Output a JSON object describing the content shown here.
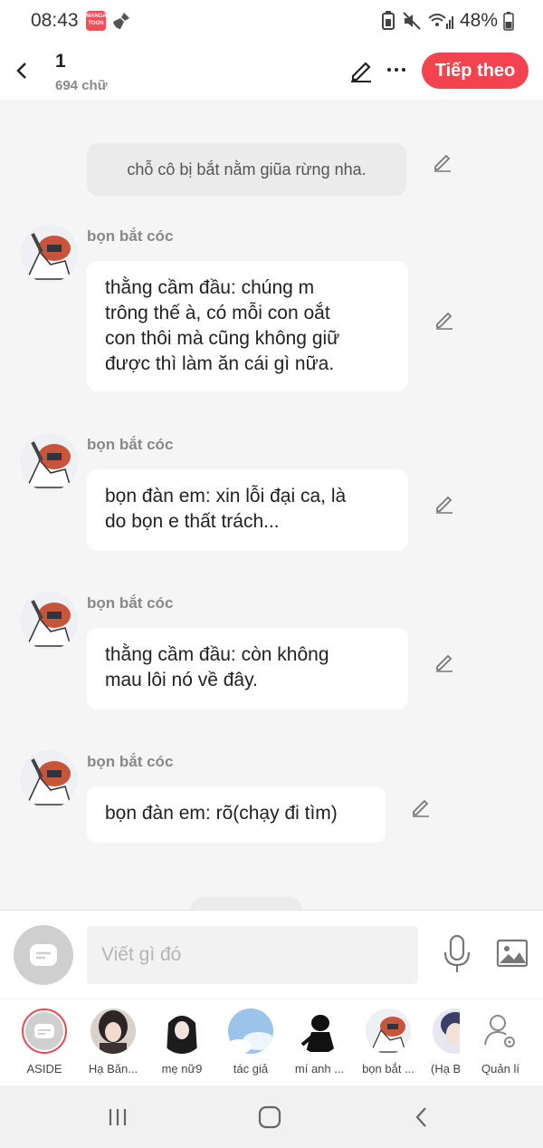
{
  "status_bar": {
    "time": "08:43",
    "app_icon_text": "MANGA TOON",
    "battery": "48%"
  },
  "header": {
    "chapter": "1",
    "char_count": "694 chữ",
    "next_label": "Tiếp theo"
  },
  "chat": {
    "narration": "chỗ cô bị bắt nằm giũa rừng nha.",
    "messages": [
      {
        "name": "bọn bắt cóc",
        "text": "thằng cầm đầu: chúng m\ntrông thế à, có mỗi con oắt\ncon thôi mà cũng không giữ\nđược thì làm ăn cái gì nữa."
      },
      {
        "name": "bọn bắt cóc",
        "text": "bọn đàn em: xin lỗi đại ca, là\ndo bọn e thất trách..."
      },
      {
        "name": "bọn bắt cóc",
        "text": "thằng cầm đầu: còn không\nmau lôi nó về đây."
      },
      {
        "name": "bọn bắt cóc",
        "text": "bọn đàn em: rõ(chạy đi tìm)"
      }
    ]
  },
  "input": {
    "placeholder": "Viết gì đó"
  },
  "characters": [
    {
      "label": "ASIDE",
      "icon": "aside-icon"
    },
    {
      "label": "Hạ Băn...",
      "icon": "avatar"
    },
    {
      "label": "mẹ nữ9",
      "icon": "avatar"
    },
    {
      "label": "tác giả",
      "icon": "avatar"
    },
    {
      "label": "mí anh ...",
      "icon": "avatar"
    },
    {
      "label": "bọn bắt ...",
      "icon": "avatar"
    },
    {
      "label": "(Hạ B",
      "icon": "avatar"
    },
    {
      "label": "Quản lí",
      "icon": "manage-user-icon"
    }
  ],
  "colors": {
    "accent": "#f2434f",
    "bubble": "#ffffff",
    "background": "#f5f5f5"
  }
}
